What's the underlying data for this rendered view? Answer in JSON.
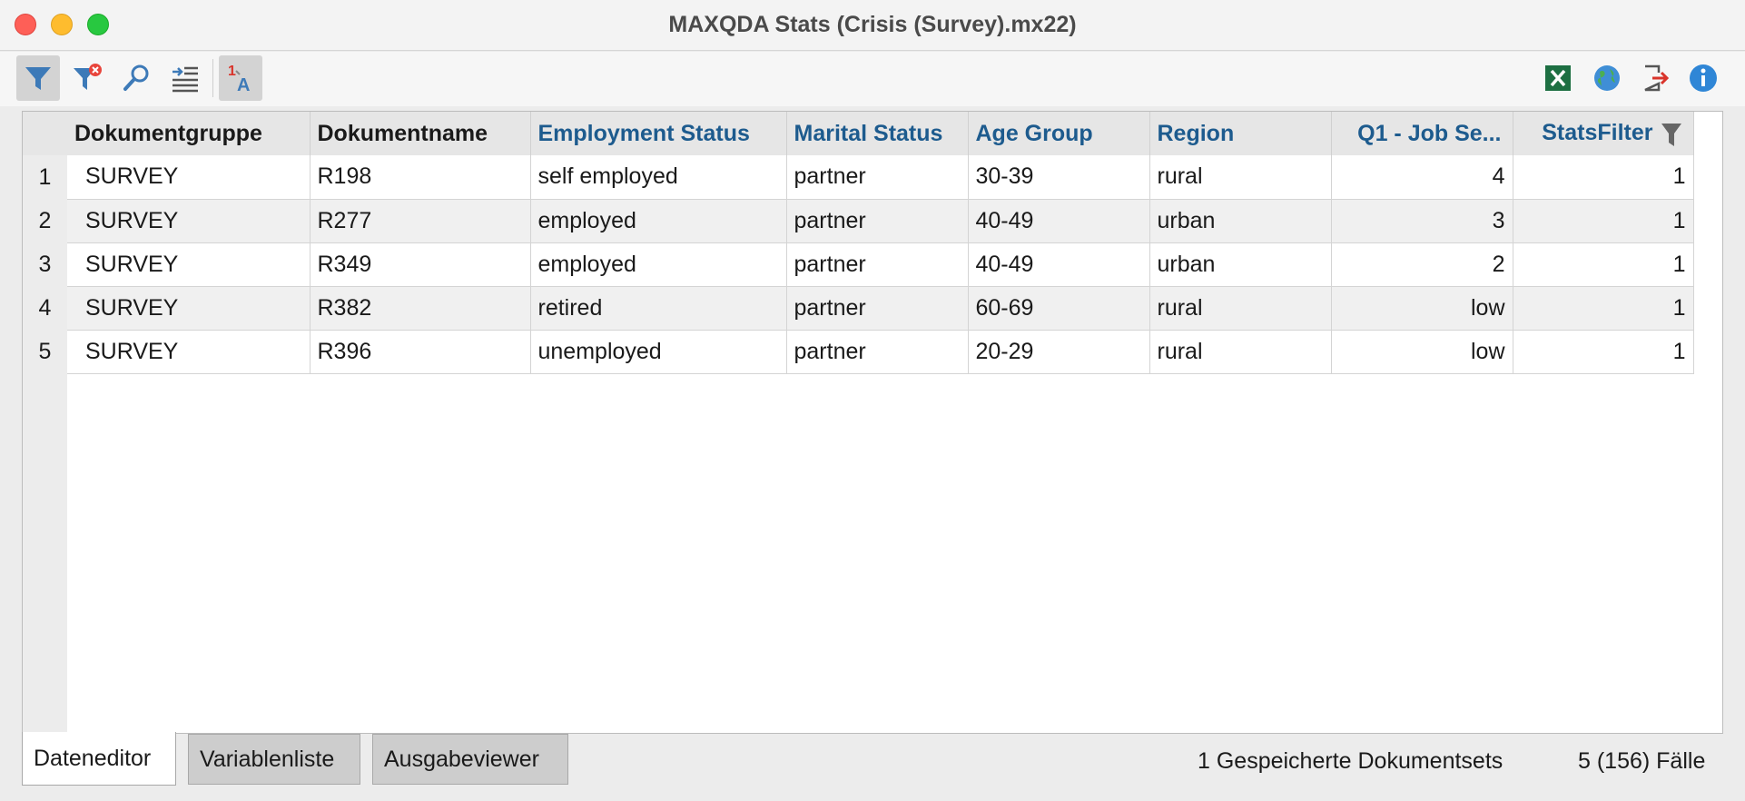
{
  "window": {
    "title": "MAXQDA Stats (Crisis (Survey).mx22)"
  },
  "toolbar": {
    "left_tools": [
      "filter-icon",
      "clear-filter-icon",
      "search-icon",
      "indent-list-icon",
      "label-value-toggle-icon"
    ],
    "right_tools": [
      "excel-export-icon",
      "web-export-icon",
      "exit-icon",
      "info-icon"
    ]
  },
  "table": {
    "columns": [
      "Dokumentgruppe",
      "Dokumentname",
      "Employment Status",
      "Marital Status",
      "Age Group",
      "Region",
      "Q1 - Job Se...",
      "StatsFilter"
    ],
    "rows": [
      {
        "num": "1",
        "cells": [
          "SURVEY",
          "R198",
          "self employed",
          "partner",
          "30-39",
          "rural",
          "4",
          "1"
        ]
      },
      {
        "num": "2",
        "cells": [
          "SURVEY",
          "R277",
          "employed",
          "partner",
          "40-49",
          "urban",
          "3",
          "1"
        ]
      },
      {
        "num": "3",
        "cells": [
          "SURVEY",
          "R349",
          "employed",
          "partner",
          "40-49",
          "urban",
          "2",
          "1"
        ]
      },
      {
        "num": "4",
        "cells": [
          "SURVEY",
          "R382",
          "retired",
          "partner",
          "60-69",
          "rural",
          "low",
          "1"
        ]
      },
      {
        "num": "5",
        "cells": [
          "SURVEY",
          "R396",
          "unemployed",
          "partner",
          "20-29",
          "rural",
          "low",
          "1"
        ]
      }
    ]
  },
  "tabs": [
    "Dateneditor",
    "Variablenliste",
    "Ausgabeviewer"
  ],
  "status": {
    "docsets": "1 Gespeicherte Dokumentsets",
    "cases": "5 (156) Fälle"
  },
  "colors": {
    "variable_header": "#1d5b8e",
    "accent_blue": "#3d7ab8"
  }
}
